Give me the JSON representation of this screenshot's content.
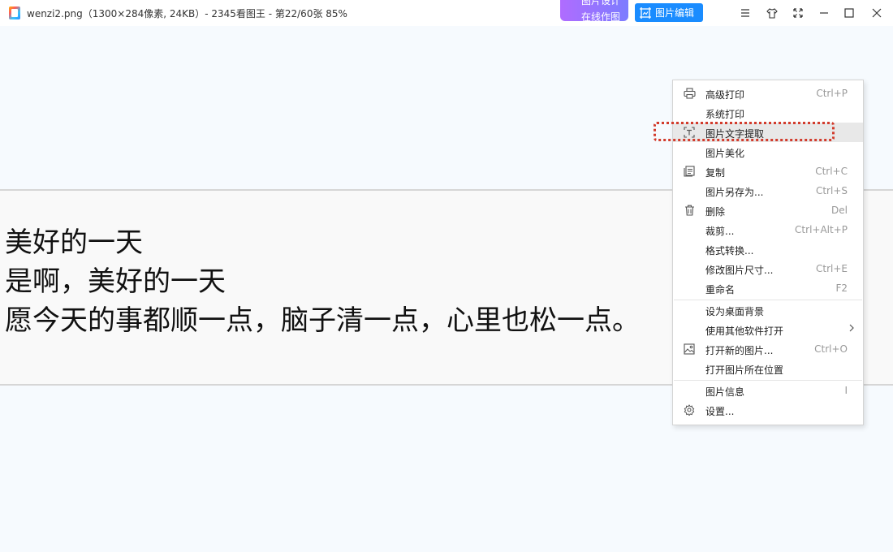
{
  "window": {
    "title": "wenzi2.png（1300×284像素, 24KB）- 2345看图王 - 第22/60张 85%",
    "buttons": {
      "design_top": "图片设计",
      "design_bottom": "在线作图",
      "edit": "图片编辑"
    }
  },
  "image": {
    "lines": [
      "美好的一天",
      "是啊，美好的一天",
      "愿今天的事都顺一点，脑子清一点，心里也松一点。"
    ]
  },
  "menu": {
    "items": [
      {
        "label": "高级打印",
        "shortcut": "Ctrl+P",
        "icon": "printer-icon"
      },
      {
        "label": "系统打印",
        "shortcut": ""
      },
      {
        "label": "图片文字提取",
        "shortcut": "",
        "icon": "text-extract-icon"
      },
      {
        "label": "图片美化",
        "shortcut": ""
      },
      {
        "label": "复制",
        "shortcut": "Ctrl+C",
        "icon": "copy-icon"
      },
      {
        "label": "图片另存为...",
        "shortcut": "Ctrl+S"
      },
      {
        "label": "删除",
        "shortcut": "Del",
        "icon": "trash-icon"
      },
      {
        "label": "裁剪...",
        "shortcut": "Ctrl+Alt+P"
      },
      {
        "label": "格式转换...",
        "shortcut": ""
      },
      {
        "label": "修改图片尺寸...",
        "shortcut": "Ctrl+E"
      },
      {
        "label": "重命名",
        "shortcut": "F2"
      },
      {
        "label": "设为桌面背景",
        "shortcut": ""
      },
      {
        "label": "使用其他软件打开",
        "shortcut": ""
      },
      {
        "label": "打开新的图片...",
        "shortcut": "Ctrl+O",
        "icon": "image-icon"
      },
      {
        "label": "打开图片所在位置",
        "shortcut": ""
      },
      {
        "label": "图片信息",
        "shortcut": "I"
      },
      {
        "label": "设置...",
        "shortcut": "",
        "icon": "gear-icon"
      }
    ]
  },
  "colors": {
    "accent": "#1a8cff",
    "design_button": "#9a74ff",
    "highlight_dashed": "#d23b2c"
  }
}
